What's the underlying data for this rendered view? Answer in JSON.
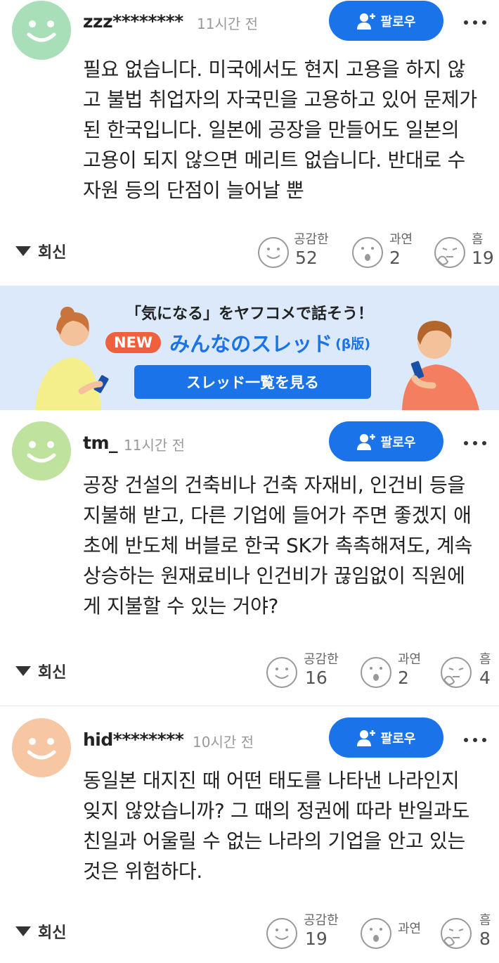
{
  "colors": {
    "accent": "#1a73e8",
    "new_badge": "#f0603c",
    "banner_bg": "#dbe9fb"
  },
  "comments": [
    {
      "avatar_color": "#a9dfb8",
      "username": "zzz********",
      "time": "11시간 전",
      "follow_label": "팔로우",
      "lines": [
        "필요 없습니다. 미국에서도 현지 고용을 하지 않",
        "고 불법 취업자의 자국민을 고용하고 있어 문제가",
        "된 한국입니다. 일본에 공장을 만들어도 일본의",
        "고용이 되지 않으면 메리트 없습니다. 반대로 수",
        "자원 등의 단점이 늘어날 뿐"
      ],
      "reply_label": "회신",
      "reactions": [
        {
          "icon": "smile-icon",
          "label": "공감한",
          "count": "52"
        },
        {
          "icon": "surprised-icon",
          "label": "과연",
          "count": "2"
        },
        {
          "icon": "thinking-icon",
          "label": "흠",
          "count": "19"
        }
      ]
    },
    {
      "avatar_color": "#bfe39e",
      "username": "tm_",
      "time": "11시간 전",
      "follow_label": "팔로우",
      "lines": [
        "공장 건설의 건축비나 건축 자재비, 인건비 등을",
        "지불해 받고, 다른 기업에 들어가 주면 좋겠지 애",
        "초에 반도체 버블로 한국 SK가 촉촉해져도, 계속",
        "상승하는 원재료비나 인건비가 끊임없이 직원에",
        "게 지불할 수 있는 거야?"
      ],
      "reply_label": "회신",
      "reactions": [
        {
          "icon": "smile-icon",
          "label": "공감한",
          "count": "16"
        },
        {
          "icon": "surprised-icon",
          "label": "과연",
          "count": "2"
        },
        {
          "icon": "thinking-icon",
          "label": "흠",
          "count": "4"
        }
      ]
    },
    {
      "avatar_color": "#f7c6a3",
      "username": "hid********",
      "time": "10시간 전",
      "follow_label": "팔로우",
      "lines": [
        "동일본 대지진 때 어떤 태도를 나타낸 나라인지",
        "잊지 않았습니까? 그 때의 정권에 따라 반일과도",
        "친일과 어울릴 수 없는 나라의 기업을 안고 있는",
        "것은 위험하다."
      ],
      "reply_label": "회신",
      "reactions": [
        {
          "icon": "smile-icon",
          "label": "공감한",
          "count": "19"
        },
        {
          "icon": "surprised-icon",
          "label": "과연",
          "count": ""
        },
        {
          "icon": "thinking-icon",
          "label": "흠",
          "count": "8"
        }
      ]
    }
  ],
  "banner": {
    "headline": "「気になる」をヤフコメで話そう！",
    "badge": "NEW",
    "title": "みんなのスレッド",
    "beta": "(β版)",
    "button": "スレッド一覧を見る"
  }
}
